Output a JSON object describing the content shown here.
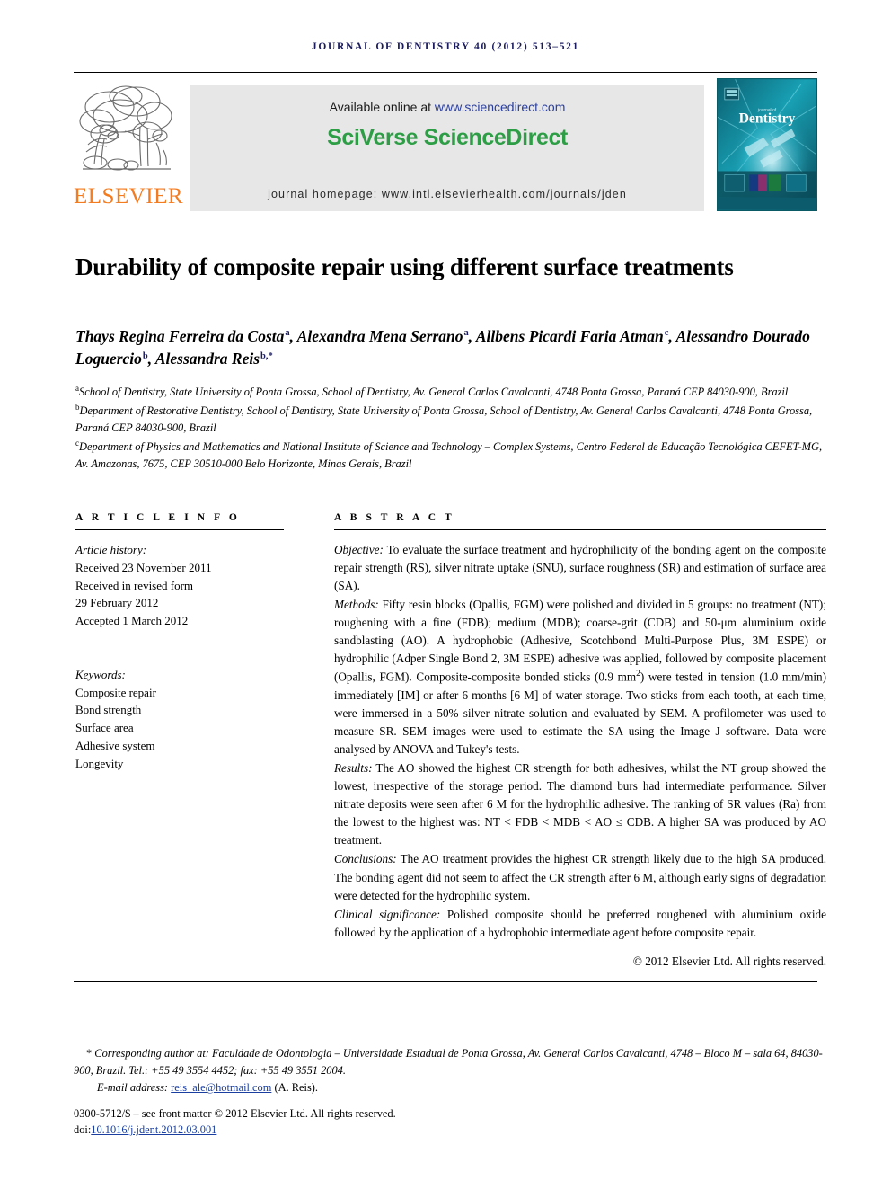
{
  "running_head": "Journal of Dentistry 40 (2012) 513–521",
  "masthead": {
    "publisher_name": "ELSEVIER",
    "publisher_logo_icon": "elsevier-tree-icon",
    "available_prefix": "Available online at ",
    "available_url": "www.sciencedirect.com",
    "brand_sci": "SciVerse ",
    "brand_verse": "ScienceDirect",
    "homepage": "journal homepage: www.intl.elsevierhealth.com/journals/jden",
    "cover_title": "Dentistry",
    "cover_overline": "journal of"
  },
  "article": {
    "title": "Durability of composite repair using different surface treatments",
    "authors": [
      {
        "name": "Thays Regina Ferreira da Costa",
        "marks": "a",
        "sep": ", "
      },
      {
        "name": "Alexandra Mena Serrano",
        "marks": "a",
        "sep": ", "
      },
      {
        "name": "Allbens Picardi Faria Atman",
        "marks": "c",
        "sep": ", "
      },
      {
        "name": "Alessandro Dourado Loguercio",
        "marks": "b",
        "sep": ", "
      },
      {
        "name": "Alessandra Reis",
        "marks": "b,*",
        "sep": ""
      }
    ],
    "affiliations": [
      {
        "mark": "a",
        "text": "School of Dentistry, State University of Ponta Grossa, School of Dentistry, Av. General Carlos Cavalcanti, 4748 Ponta Grossa, Paraná CEP 84030-900, Brazil"
      },
      {
        "mark": "b",
        "text": "Department of Restorative Dentistry, School of Dentistry, State University of Ponta Grossa, School of Dentistry, Av. General Carlos Cavalcanti, 4748 Ponta Grossa, Paraná CEP 84030-900, Brazil"
      },
      {
        "mark": "c",
        "text": "Department of Physics and Mathematics and National Institute of Science and Technology – Complex Systems, Centro Federal de Educação Tecnológica CEFET-MG, Av. Amazonas, 7675, CEP 30510-000 Belo Horizonte, Minas Gerais, Brazil"
      }
    ]
  },
  "article_info": {
    "heading": "A R T I C L E  I N F O",
    "history_label": "Article history:",
    "received": "Received 23 November 2011",
    "revised_label": "Received in revised form",
    "revised_date": "29 February 2012",
    "accepted": "Accepted 1 March 2012",
    "keywords_label": "Keywords:",
    "keywords": [
      "Composite repair",
      "Bond strength",
      "Surface area",
      "Adhesive system",
      "Longevity"
    ]
  },
  "abstract": {
    "heading": "A B S T R A C T",
    "objective_label": "Objective:",
    "objective_text": " To evaluate the surface treatment and hydrophilicity of the bonding agent on the composite repair strength (RS), silver nitrate uptake (SNU), surface roughness (SR) and estimation of surface area (SA).",
    "methods_label": "Methods:",
    "methods_text_a": " Fifty resin blocks (Opallis, FGM) were polished and divided in 5 groups: no treatment (NT); roughening with a fine (FDB); medium (MDB); coarse-grit (CDB) and 50-μm aluminium oxide sandblasting (AO). A hydrophobic (Adhesive, Scotchbond Multi-Purpose Plus, 3M ESPE) or hydrophilic (Adper Single Bond 2, 3M ESPE) adhesive was applied, followed by composite placement (Opallis, FGM). Composite-composite bonded sticks (0.9 mm",
    "methods_sup": "2",
    "methods_text_b": ") were tested in tension (1.0 mm/min) immediately [IM] or after 6 months [6 M] of water storage. Two sticks from each tooth, at each time, were immersed in a 50% silver nitrate solution and evaluated by SEM. A profilometer was used to measure SR. SEM images were used to estimate the SA using the Image J software. Data were analysed by ANOVA and Tukey's tests.",
    "results_label": "Results:",
    "results_text": " The AO showed the highest CR strength for both adhesives, whilst the NT group showed the lowest, irrespective of the storage period. The diamond burs had intermediate performance. Silver nitrate deposits were seen after 6 M for the hydrophilic adhesive. The ranking of SR values (Ra) from the lowest to the highest was: NT < FDB < MDB < AO ≤ CDB. A higher SA was produced by AO treatment.",
    "conclusions_label": "Conclusions:",
    "conclusions_text": " The AO treatment provides the highest CR strength likely due to the high SA produced. The bonding agent did not seem to affect the CR strength after 6 M, although early signs of degradation were detected for the hydrophilic system.",
    "clinical_label": "Clinical significance:",
    "clinical_text": " Polished composite should be preferred roughened with aluminium oxide followed by the application of a hydrophobic intermediate agent before composite repair.",
    "copyright": "© 2012 Elsevier Ltd. All rights reserved."
  },
  "footer": {
    "corresponding_star": "*",
    "corresponding_text": " Corresponding author at: Faculdade de Odontologia – Universidade Estadual de Ponta Grossa, Av. General Carlos Cavalcanti, 4748 – Bloco M – sala 64, 84030-900, Brazil. Tel.: +55 49 3554 4452; fax: +55 49 3551 2004.",
    "email_label": "E-mail address:",
    "email_address": "reis_ale@hotmail.com",
    "email_suffix": " (A. Reis).",
    "issn_line": "0300-5712/$ – see front matter © 2012 Elsevier Ltd. All rights reserved.",
    "doi_label": "doi:",
    "doi_value": "10.1016/j.jdent.2012.03.001"
  },
  "colors": {
    "navy": "#1b1b5e",
    "link_blue": "#1a3fa0",
    "elsevier_orange": "#f47c20",
    "sciencedirect_green": "#2d9e45",
    "box_gray": "#e7e7e7",
    "cover_teal": "#0d6f7e"
  }
}
